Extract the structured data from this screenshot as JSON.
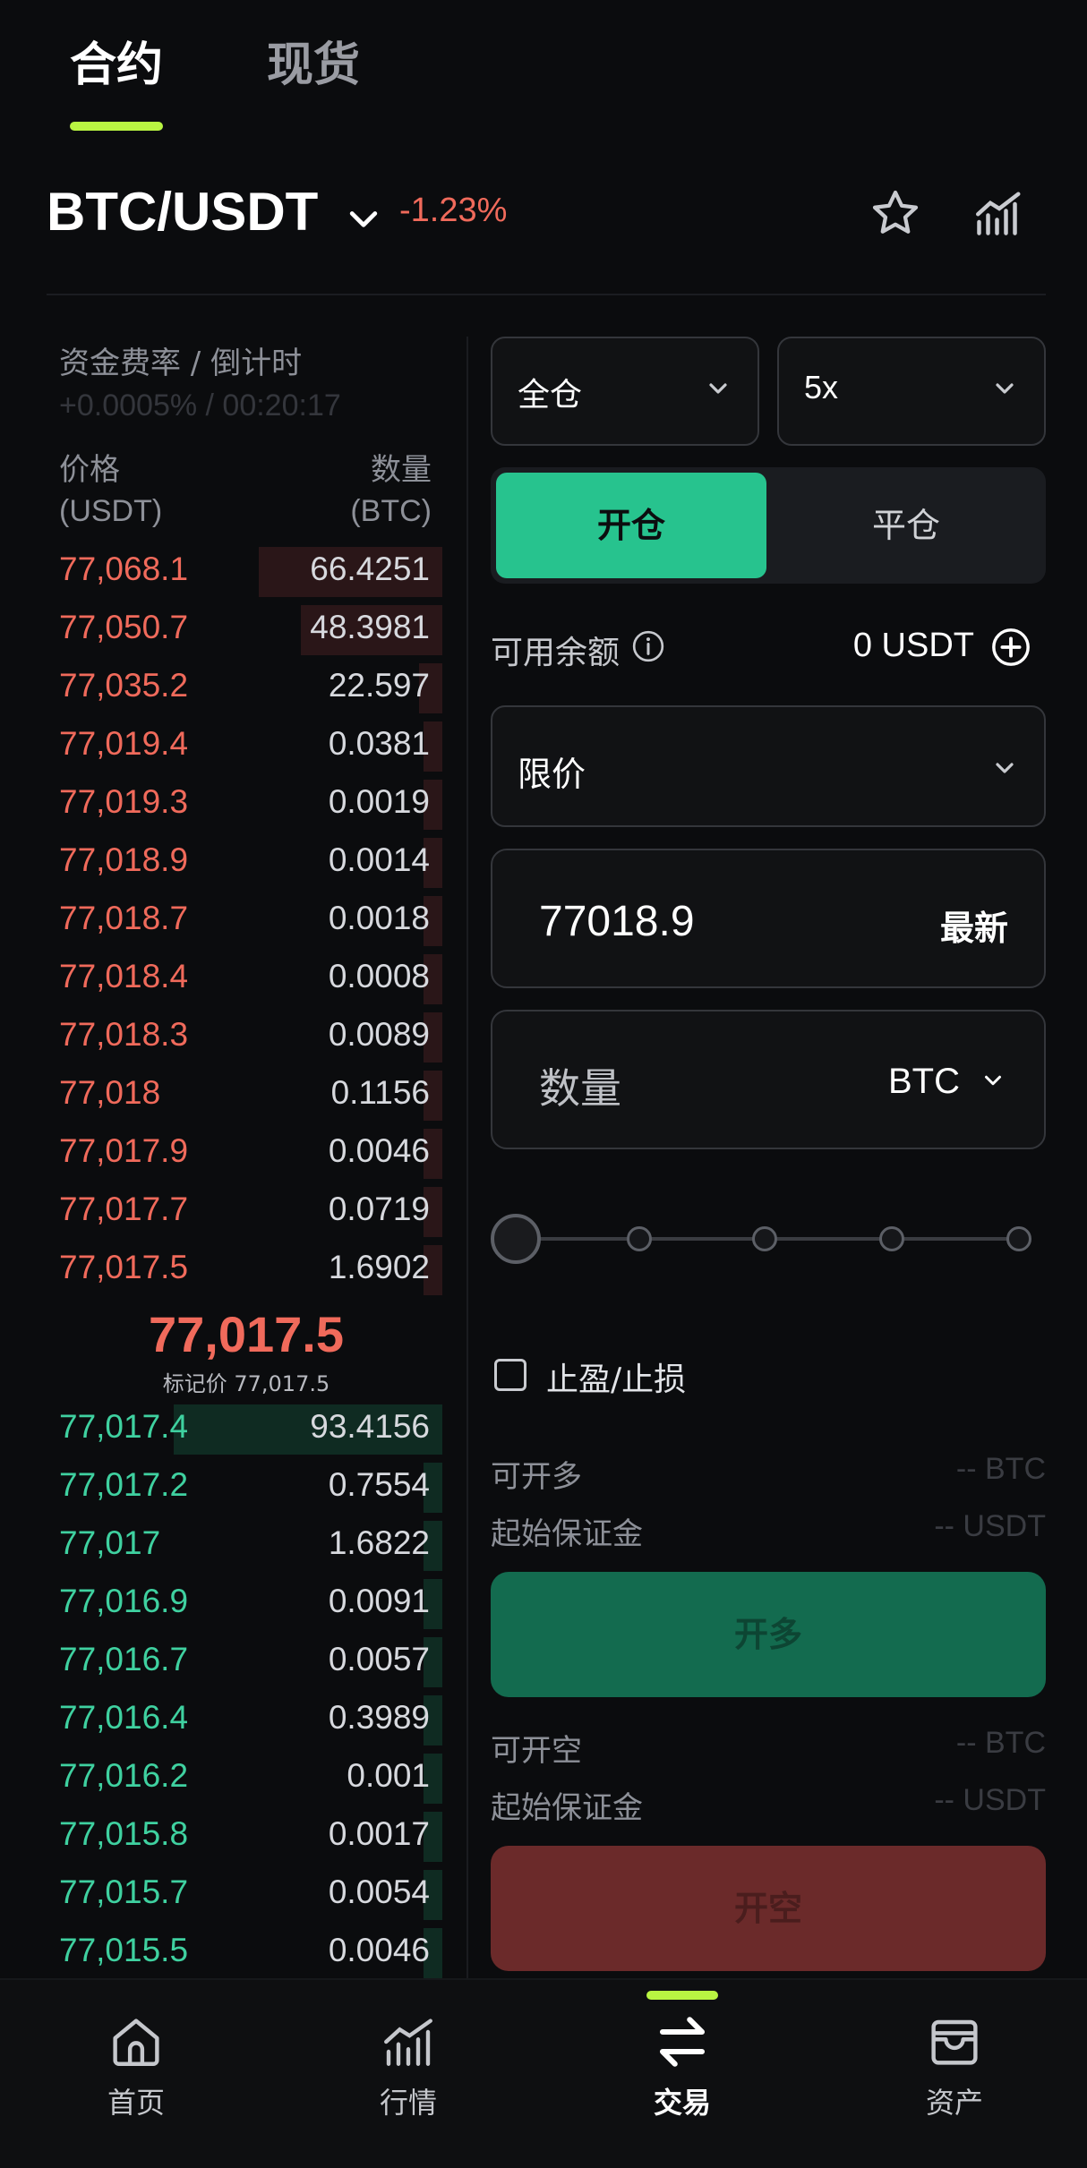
{
  "top_tabs": {
    "futures": "合约",
    "spot": "现货"
  },
  "pair": {
    "symbol": "BTC/USDT",
    "change": "-1.23%"
  },
  "icons": {
    "caret": "chevron-down-icon",
    "favorite": "star-icon",
    "chart": "chart-bars-icon",
    "info": "info-icon",
    "add": "plus-circle-icon"
  },
  "funding": {
    "label": "资金费率 / 倒计时",
    "value": "+0.0005% / 00:20:17"
  },
  "book_headers": {
    "price_label": "价格",
    "price_unit": "(USDT)",
    "qty_label": "数量",
    "qty_unit": "(BTC)"
  },
  "asks": [
    {
      "price": "77,068.1",
      "qty": "66.4251",
      "depth": 0.48
    },
    {
      "price": "77,050.7",
      "qty": "48.3981",
      "depth": 0.37
    },
    {
      "price": "77,035.2",
      "qty": "22.597",
      "depth": 0.06
    },
    {
      "price": "77,019.4",
      "qty": "0.0381",
      "depth": 0.05
    },
    {
      "price": "77,019.3",
      "qty": "0.0019",
      "depth": 0.05
    },
    {
      "price": "77,018.9",
      "qty": "0.0014",
      "depth": 0.05
    },
    {
      "price": "77,018.7",
      "qty": "0.0018",
      "depth": 0.05
    },
    {
      "price": "77,018.4",
      "qty": "0.0008",
      "depth": 0.05
    },
    {
      "price": "77,018.3",
      "qty": "0.0089",
      "depth": 0.05
    },
    {
      "price": "77,018",
      "qty": "0.1156",
      "depth": 0.05
    },
    {
      "price": "77,017.9",
      "qty": "0.0046",
      "depth": 0.05
    },
    {
      "price": "77,017.7",
      "qty": "0.0719",
      "depth": 0.05
    },
    {
      "price": "77,017.5",
      "qty": "1.6902",
      "depth": 0.05
    }
  ],
  "last_price": "77,017.5",
  "mark_price": "标记价 77,017.5",
  "bids": [
    {
      "price": "77,017.4",
      "qty": "93.4156",
      "depth": 0.7
    },
    {
      "price": "77,017.2",
      "qty": "0.7554",
      "depth": 0.05
    },
    {
      "price": "77,017",
      "qty": "1.6822",
      "depth": 0.05
    },
    {
      "price": "77,016.9",
      "qty": "0.0091",
      "depth": 0.05
    },
    {
      "price": "77,016.7",
      "qty": "0.0057",
      "depth": 0.05
    },
    {
      "price": "77,016.4",
      "qty": "0.3989",
      "depth": 0.05
    },
    {
      "price": "77,016.2",
      "qty": "0.001",
      "depth": 0.05
    },
    {
      "price": "77,015.8",
      "qty": "0.0017",
      "depth": 0.05
    },
    {
      "price": "77,015.7",
      "qty": "0.0054",
      "depth": 0.05
    },
    {
      "price": "77,015.5",
      "qty": "0.0046",
      "depth": 0.05
    }
  ],
  "trade_panel": {
    "margin_mode": "全仓",
    "leverage": "5x",
    "open_label": "开仓",
    "close_label": "平仓",
    "balance_label": "可用余额",
    "balance_value": "0 USDT",
    "order_type": "限价",
    "price_value": "77018.9",
    "latest_label": "最新",
    "qty_placeholder": "数量",
    "qty_unit": "BTC",
    "slider_fraction": 0,
    "tpsl_label": "止盈/止损",
    "long_max_label": "可开多",
    "long_max_value": "-- BTC",
    "long_margin_label": "起始保证金",
    "long_margin_value": "-- USDT",
    "long_button": "开多",
    "short_max_label": "可开空",
    "short_max_value": "-- BTC",
    "short_margin_label": "起始保证金",
    "short_margin_value": "-- USDT",
    "short_button": "开空"
  },
  "bottom_nav": [
    {
      "label": "首页",
      "icon": "home-icon"
    },
    {
      "label": "行情",
      "icon": "market-chart-icon"
    },
    {
      "label": "交易",
      "icon": "swap-arrows-icon",
      "active": true
    },
    {
      "label": "资产",
      "icon": "wallet-icon"
    }
  ],
  "colors": {
    "accent": "#b9f542",
    "ask": "#f06a5b",
    "bid": "#3fd1a0",
    "open_toggle": "#27c38e",
    "long_button": "#136b4f",
    "short_button": "#6b2a2a"
  }
}
